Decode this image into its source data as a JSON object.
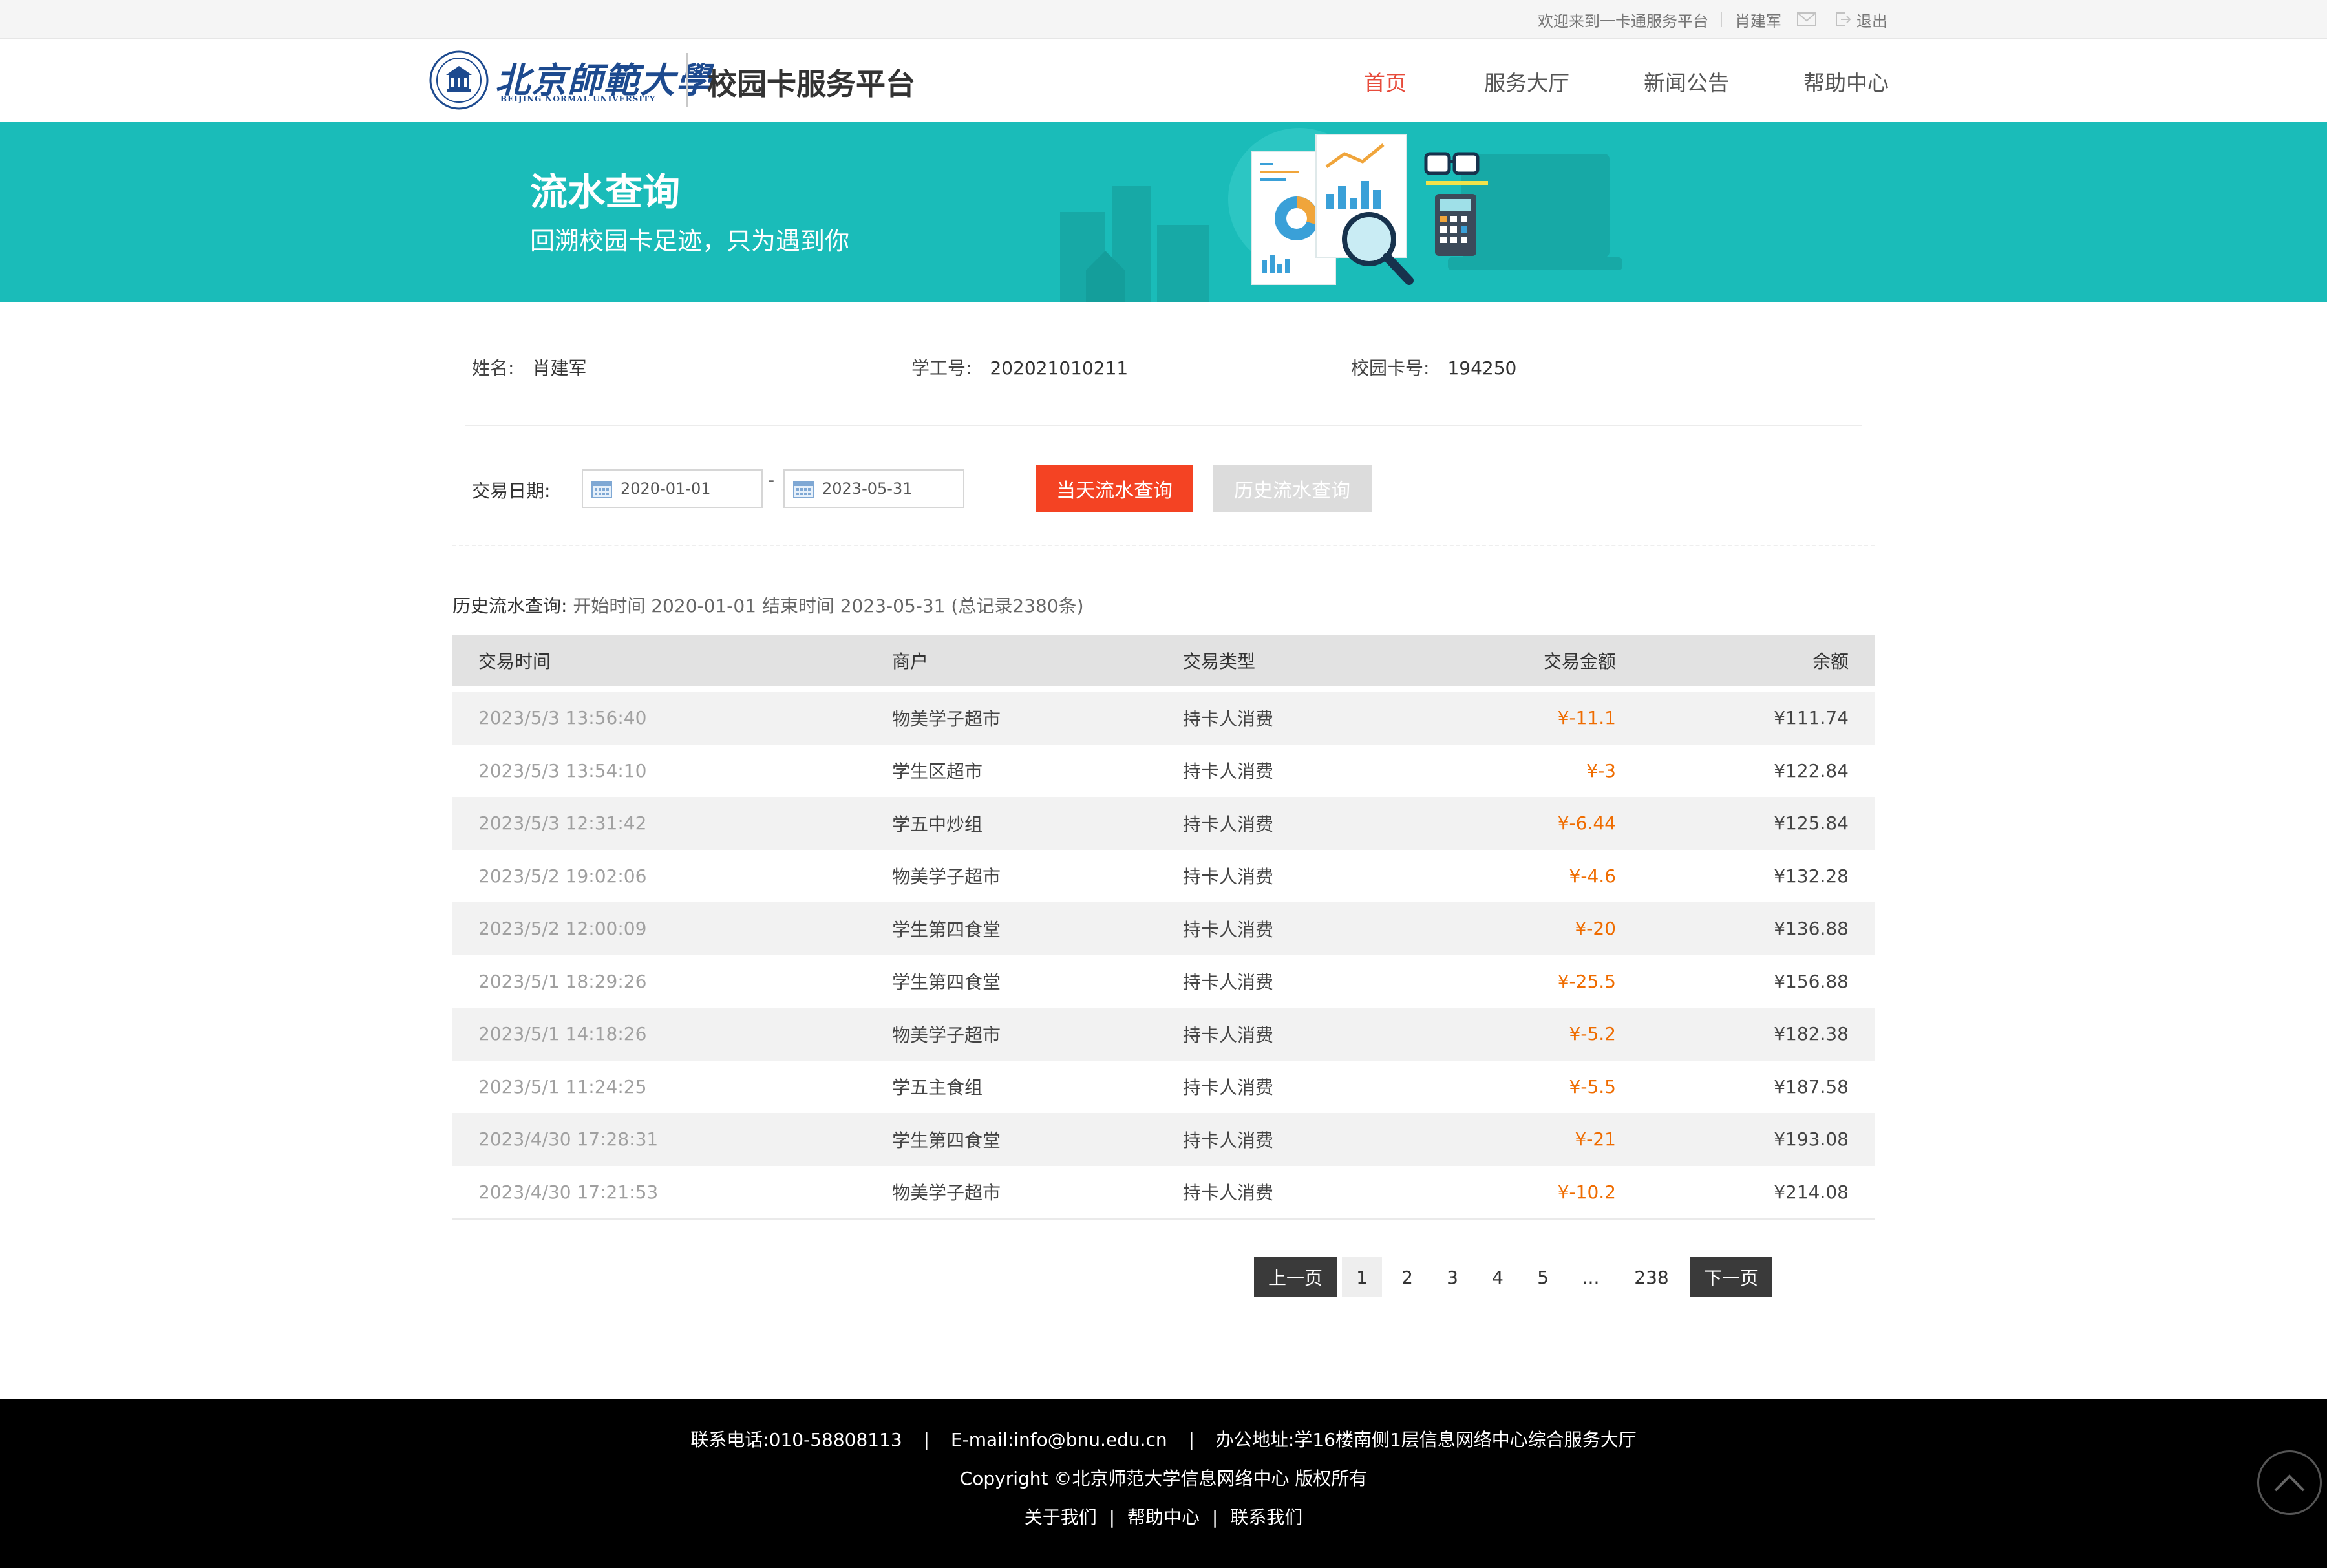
{
  "topbar": {
    "welcome": "欢迎来到一卡通服务平台",
    "username": "肖建军",
    "logout": "退出"
  },
  "header": {
    "logo_cn": "北京師範大學",
    "logo_en": "BEIJING NORMAL UNIVERSITY",
    "platform_title": "校园卡服务平台",
    "nav": [
      {
        "label": "首页",
        "active": true
      },
      {
        "label": "服务大厅",
        "active": false
      },
      {
        "label": "新闻公告",
        "active": false
      },
      {
        "label": "帮助中心",
        "active": false
      }
    ]
  },
  "banner": {
    "title": "流水查询",
    "subtitle": "回溯校园卡足迹，只为遇到你"
  },
  "user_info": {
    "name_label": "姓名:",
    "name": "肖建军",
    "id_label": "学工号:",
    "id": "202021010211",
    "card_label": "校园卡号:",
    "card": "194250"
  },
  "query": {
    "date_label": "交易日期:",
    "start_date": "2020-01-01",
    "end_date": "2023-05-31",
    "dash": "-",
    "today_button": "当天流水查询",
    "history_button": "历史流水查询"
  },
  "summary": {
    "title": "历史流水查询:",
    "text": "开始时间 2020-01-01 结束时间 2023-05-31 (总记录2380条)"
  },
  "table": {
    "headers": [
      "交易时间",
      "商户",
      "交易类型",
      "交易金额",
      "余额"
    ],
    "rows": [
      [
        "2023/5/3 13:56:40",
        "物美学子超市",
        "持卡人消费",
        "¥-11.1",
        "¥111.74"
      ],
      [
        "2023/5/3 13:54:10",
        "学生区超市",
        "持卡人消费",
        "¥-3",
        "¥122.84"
      ],
      [
        "2023/5/3 12:31:42",
        "学五中炒组",
        "持卡人消费",
        "¥-6.44",
        "¥125.84"
      ],
      [
        "2023/5/2 19:02:06",
        "物美学子超市",
        "持卡人消费",
        "¥-4.6",
        "¥132.28"
      ],
      [
        "2023/5/2 12:00:09",
        "学生第四食堂",
        "持卡人消费",
        "¥-20",
        "¥136.88"
      ],
      [
        "2023/5/1 18:29:26",
        "学生第四食堂",
        "持卡人消费",
        "¥-25.5",
        "¥156.88"
      ],
      [
        "2023/5/1 14:18:26",
        "物美学子超市",
        "持卡人消费",
        "¥-5.2",
        "¥182.38"
      ],
      [
        "2023/5/1 11:24:25",
        "学五主食组",
        "持卡人消费",
        "¥-5.5",
        "¥187.58"
      ],
      [
        "2023/4/30 17:28:31",
        "学生第四食堂",
        "持卡人消费",
        "¥-21",
        "¥193.08"
      ],
      [
        "2023/4/30 17:21:53",
        "物美学子超市",
        "持卡人消费",
        "¥-10.2",
        "¥214.08"
      ]
    ]
  },
  "pagination": {
    "prev": "上一页",
    "pages": [
      "1",
      "2",
      "3",
      "4",
      "5"
    ],
    "ellipsis": "...",
    "last": "238",
    "next": "下一页",
    "current": "1"
  },
  "footer": {
    "phone_label": "联系电话:",
    "phone": "010-58808113",
    "email_label": "E-mail:",
    "email": "info@bnu.edu.cn",
    "address_label": "办公地址:",
    "address": "学16楼南侧1层信息网络中心综合服务大厅",
    "copyright": "Copyright ©北京师范大学信息网络中心 版权所有",
    "links": [
      "关于我们",
      "帮助中心",
      "联系我们"
    ]
  },
  "colors": {
    "accent": "#1abcb9",
    "nav_active": "#e74c3c",
    "button_primary": "#f44323",
    "amount": "#ef6c00",
    "footer_bg": "#000000"
  }
}
